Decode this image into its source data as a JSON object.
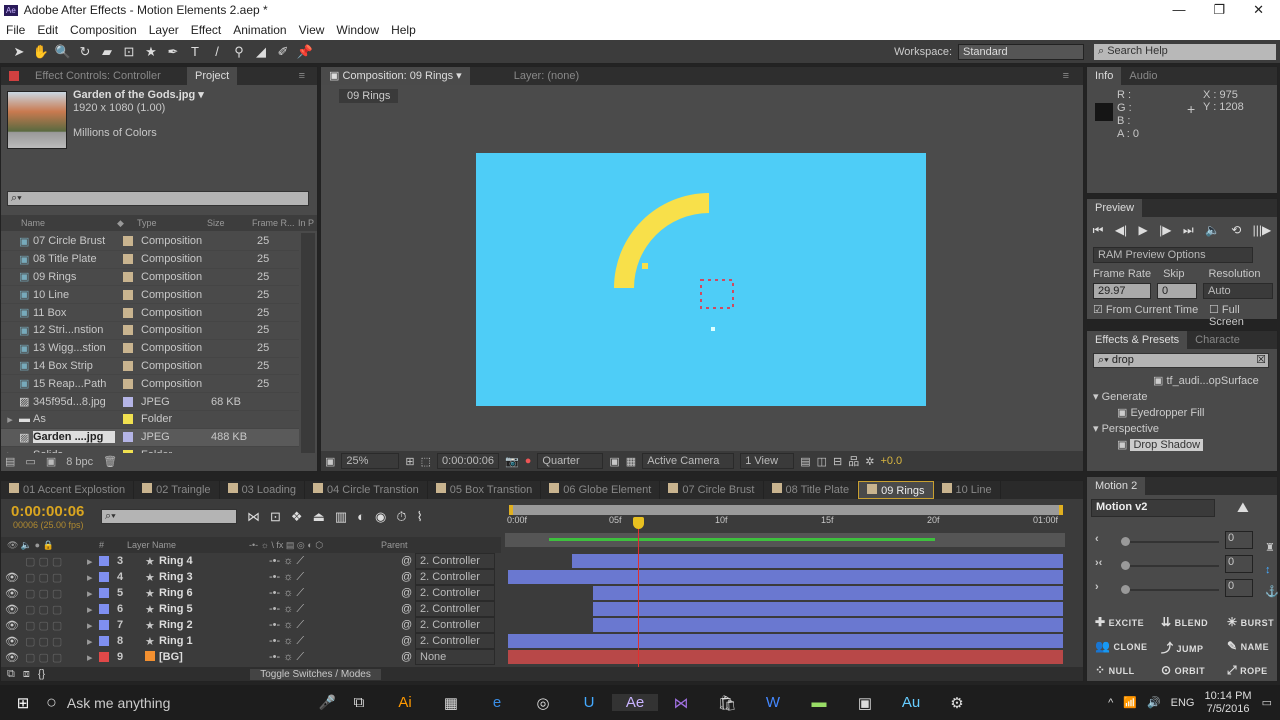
{
  "window": {
    "title": "Adobe After Effects - Motion Elements 2.aep *",
    "app_icon": "Ae",
    "controls": [
      "minimize",
      "restore",
      "close"
    ]
  },
  "menu": [
    "File",
    "Edit",
    "Composition",
    "Layer",
    "Effect",
    "Animation",
    "View",
    "Window",
    "Help"
  ],
  "toolbar": {
    "tools": [
      "selection-icon",
      "hand-icon",
      "zoom-icon",
      "rotate-icon",
      "camera-icon",
      "pan-behind-icon",
      "shape-star-icon",
      "pen-icon",
      "text-icon",
      "brush-icon",
      "clone-stamp-icon",
      "eraser-icon",
      "roto-brush-icon",
      "puppet-pin-icon"
    ],
    "workspace_label": "Workspace:",
    "workspace_value": "Standard",
    "search_placeholder": "Search Help"
  },
  "project": {
    "tabs": [
      "Effect Controls: Controller",
      "Project"
    ],
    "preview": {
      "name": "Garden of the Gods.jpg ▾",
      "dims": "1920 x 1080 (1.00)",
      "colors": "Millions of Colors"
    },
    "columns": [
      "Name",
      "Type",
      "Size",
      "Frame R...",
      "In P"
    ],
    "items": [
      {
        "name": "07 Circle Brust",
        "type": "Composition",
        "size": "",
        "fr": "25",
        "color": "#c9b48f",
        "icon": "comp"
      },
      {
        "name": "08 Title Plate",
        "type": "Composition",
        "size": "",
        "fr": "25",
        "color": "#c9b48f",
        "icon": "comp"
      },
      {
        "name": "09 Rings",
        "type": "Composition",
        "size": "",
        "fr": "25",
        "color": "#c9b48f",
        "icon": "comp"
      },
      {
        "name": "10 Line",
        "type": "Composition",
        "size": "",
        "fr": "25",
        "color": "#c9b48f",
        "icon": "comp"
      },
      {
        "name": "11 Box",
        "type": "Composition",
        "size": "",
        "fr": "25",
        "color": "#c9b48f",
        "icon": "comp"
      },
      {
        "name": "12 Stri...nstion",
        "type": "Composition",
        "size": "",
        "fr": "25",
        "color": "#c9b48f",
        "icon": "comp"
      },
      {
        "name": "13 Wigg...stion",
        "type": "Composition",
        "size": "",
        "fr": "25",
        "color": "#c9b48f",
        "icon": "comp"
      },
      {
        "name": "14 Box Strip",
        "type": "Composition",
        "size": "",
        "fr": "25",
        "color": "#c9b48f",
        "icon": "comp"
      },
      {
        "name": "15 Reap...Path",
        "type": "Composition",
        "size": "",
        "fr": "25",
        "color": "#c9b48f",
        "icon": "comp"
      },
      {
        "name": "345f95d...8.jpg",
        "type": "JPEG",
        "size": "68 KB",
        "fr": "",
        "color": "#b4b4e6",
        "icon": "image"
      },
      {
        "name": "As",
        "type": "Folder",
        "size": "",
        "fr": "",
        "color": "#f0e050",
        "icon": "folder"
      },
      {
        "name": "Garden ....jpg",
        "type": "JPEG",
        "size": "488 KB",
        "fr": "",
        "color": "#b4b4e6",
        "icon": "image",
        "selected": true
      },
      {
        "name": "Solids",
        "type": "Folder",
        "size": "",
        "fr": "",
        "color": "#f0e050",
        "icon": "folder"
      }
    ],
    "bpc": "8 bpc"
  },
  "composition": {
    "tab": "Composition: 09 Rings",
    "layer_tab": "Layer: (none)",
    "breadcrumb": "09 Rings",
    "bg_color": "#4ecdf7",
    "ring_color": "#f8e04a",
    "footer": {
      "zoom": "25%",
      "timecode": "0:00:00:06",
      "resolution": "Quarter",
      "camera": "Active Camera",
      "views": "1 View",
      "exposure": "+0.0"
    }
  },
  "info": {
    "tabs": [
      "Info",
      "Audio"
    ],
    "r": "R :",
    "g": "G :",
    "b": "B :",
    "a": "A : 0",
    "x": "X : 975",
    "y": "Y : 1208"
  },
  "preview": {
    "tab": "Preview",
    "ram": "RAM Preview Options",
    "frame_rate_label": "Frame Rate",
    "skip_label": "Skip",
    "resolution_label": "Resolution",
    "frame_rate": "29.97",
    "skip": "0",
    "resolution": "Auto",
    "from_current": "From Current Time",
    "from_current_checked": true,
    "full_screen": "Full Screen",
    "full_screen_checked": false
  },
  "effects": {
    "tabs": [
      "Effects & Presets",
      "Characte"
    ],
    "search": "drop",
    "items": [
      {
        "label": "tf_audi...opSurface",
        "level": 2
      },
      {
        "label": "Generate",
        "level": 0
      },
      {
        "label": "Eyedropper Fill",
        "level": 1
      },
      {
        "label": "Perspective",
        "level": 0
      },
      {
        "label": "Drop Shadow",
        "level": 1,
        "selected": true
      }
    ]
  },
  "timeline": {
    "tabs": [
      "01 Accent Explostion",
      "02 Traingle",
      "03 Loading",
      "04 Circle Transtion",
      "05 Box Transtion",
      "06 Globe Element",
      "07 Circle Brust",
      "08 Title Plate",
      "09 Rings",
      "10 Line"
    ],
    "active_tab": "09 Rings",
    "timecode": "0:00:00:06",
    "fps": "00006 (25.00 fps)",
    "col_num": "#",
    "col_name": "Layer Name",
    "col_parent": "Parent",
    "toggle": "Toggle Switches / Modes",
    "ruler": [
      "0:00f",
      "05f",
      "10f",
      "15f",
      "20f",
      "01:00f"
    ],
    "current_frame": 6,
    "total_frames": 25,
    "layers": [
      {
        "num": "3",
        "name": "Ring 4",
        "color": "#7f8ff0",
        "parent": "2. Controller",
        "start": 3,
        "visible": false
      },
      {
        "num": "4",
        "name": "Ring 3",
        "color": "#7f8ff0",
        "parent": "2. Controller",
        "start": 0,
        "visible": true
      },
      {
        "num": "5",
        "name": "Ring 6",
        "color": "#7f8ff0",
        "parent": "2. Controller",
        "start": 4,
        "visible": true
      },
      {
        "num": "6",
        "name": "Ring 5",
        "color": "#7f8ff0",
        "parent": "2. Controller",
        "start": 4,
        "visible": true
      },
      {
        "num": "7",
        "name": "Ring 2",
        "color": "#7f8ff0",
        "parent": "2. Controller",
        "start": 4,
        "visible": true
      },
      {
        "num": "8",
        "name": "Ring 1",
        "color": "#7f8ff0",
        "parent": "2. Controller",
        "start": 0,
        "visible": true
      },
      {
        "num": "9",
        "name": "[BG]",
        "color": "#e04848",
        "parent": "None",
        "start": 0,
        "visible": true
      }
    ]
  },
  "motion": {
    "tab": "Motion 2",
    "preset": "Motion v2",
    "values": [
      "0",
      "0",
      "0"
    ],
    "buttons": [
      "EXCITE",
      "BLEND",
      "BURST",
      "CLONE",
      "JUMP",
      "NAME",
      "NULL",
      "ORBIT",
      "ROPE"
    ]
  },
  "taskbar": {
    "search": "Ask me anything",
    "lang": "ENG",
    "time": "10:14 PM",
    "date": "7/5/2016"
  }
}
